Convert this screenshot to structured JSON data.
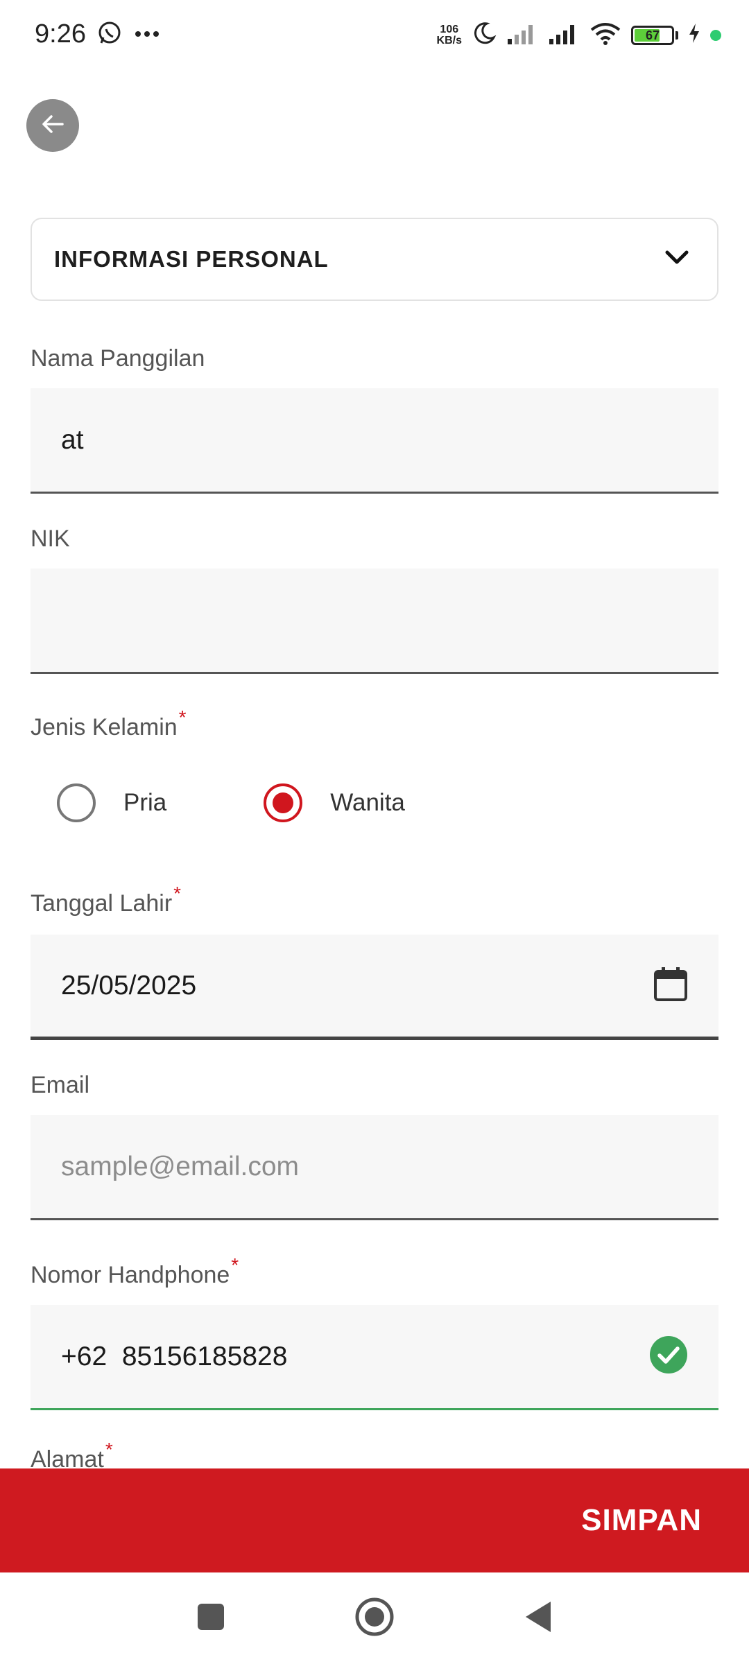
{
  "status_bar": {
    "time": "9:26",
    "icons_left": [
      "whatsapp-icon",
      "more-dots-icon"
    ],
    "net_speed_value": "106",
    "net_speed_unit": "KB/s",
    "battery_percent": "67",
    "icons_right": [
      "moon-icon",
      "signal-icon",
      "signal-icon",
      "wifi-icon",
      "battery-icon",
      "charging-icon"
    ]
  },
  "header": {
    "back_icon": "arrow-left-icon"
  },
  "section": {
    "title": "INFORMASI PERSONAL",
    "toggle_icon": "chevron-down-icon"
  },
  "form": {
    "nickname": {
      "label": "Nama Panggilan",
      "value": "at"
    },
    "nik": {
      "label": "NIK",
      "value": ""
    },
    "gender": {
      "label": "Jenis Kelamin",
      "required_mark": "*",
      "options": [
        {
          "label": "Pria",
          "selected": false
        },
        {
          "label": "Wanita",
          "selected": true
        }
      ]
    },
    "birth_date": {
      "label": "Tanggal Lahir",
      "required_mark": "*",
      "value": "25/05/2025",
      "icon": "calendar-icon"
    },
    "email": {
      "label": "Email",
      "placeholder": "sample@email.com",
      "value": ""
    },
    "phone": {
      "label": "Nomor Handphone",
      "required_mark": "*",
      "value": "+62  85156185828",
      "status_icon": "check-circle-icon"
    },
    "address": {
      "label": "Alamat",
      "required_mark": "*"
    }
  },
  "footer": {
    "save_label": "SIMPAN"
  },
  "colors": {
    "primary": "#cf1a20",
    "success": "#3ea55b",
    "field_bg": "#f7f7f7"
  },
  "nav_bar": {
    "icons": [
      "recent-apps-icon",
      "home-icon",
      "back-triangle-icon"
    ]
  }
}
